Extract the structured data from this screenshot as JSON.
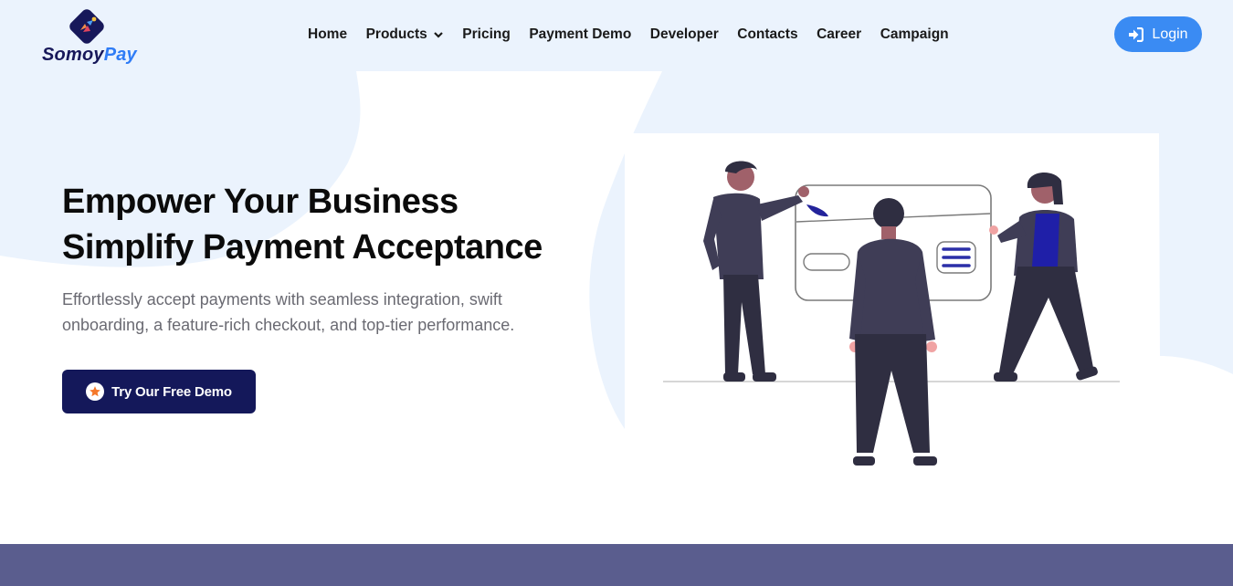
{
  "brand": {
    "name_part1": "Somoy",
    "name_part2": "Pay"
  },
  "nav": {
    "items": [
      {
        "label": "Home"
      },
      {
        "label": "Products",
        "has_dropdown": true
      },
      {
        "label": "Pricing"
      },
      {
        "label": "Payment Demo"
      },
      {
        "label": "Developer"
      },
      {
        "label": "Contacts"
      },
      {
        "label": "Career"
      },
      {
        "label": "Campaign"
      }
    ],
    "login_label": "Login",
    "login_icon": "sign-in-icon"
  },
  "hero": {
    "title_line1": "Empower Your Business",
    "title_line2": "Simplify Payment Acceptance",
    "subtitle": "Effortlessly accept payments with seamless integration, swift onboarding, a feature-rich checkout, and top-tier performance.",
    "cta_label": "Try Our Free Demo",
    "cta_icon": "star-icon"
  },
  "colors": {
    "accent_blue": "#3a8bf3",
    "navy": "#14185a",
    "background_tint": "#ebf3fd",
    "footer_band": "#5a5d8e",
    "star_orange": "#f5782a"
  }
}
